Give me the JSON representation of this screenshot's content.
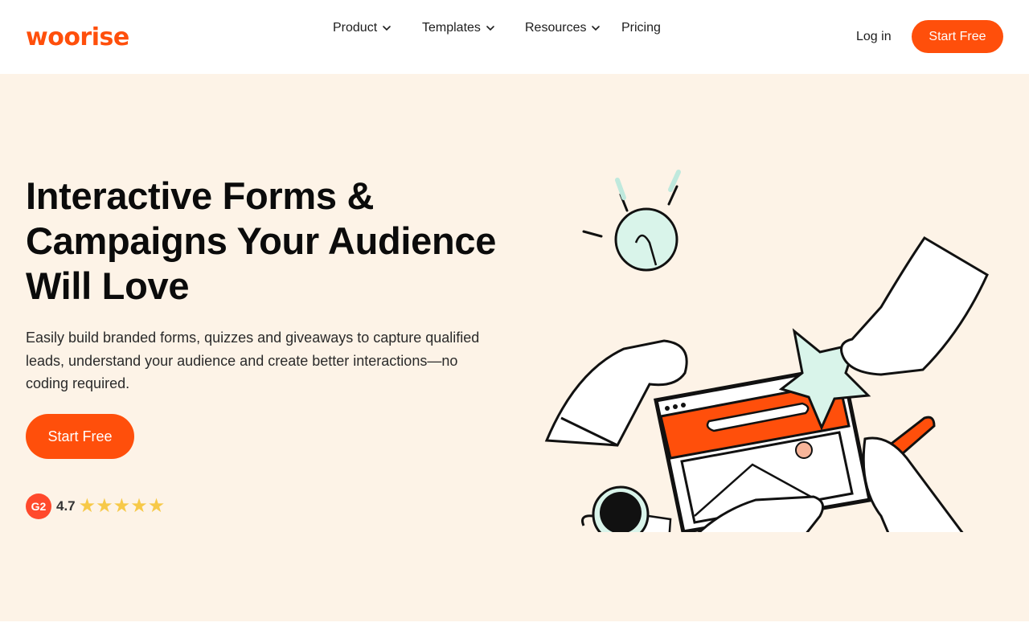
{
  "brand": {
    "name": "woorise",
    "color": "#ff4f0b"
  },
  "nav": {
    "items": [
      {
        "label": "Product",
        "has_dropdown": true
      },
      {
        "label": "Templates",
        "has_dropdown": true
      },
      {
        "label": "Resources",
        "has_dropdown": true
      },
      {
        "label": "Pricing",
        "has_dropdown": false
      }
    ],
    "login_label": "Log in",
    "cta_label": "Start Free"
  },
  "hero": {
    "title": "Interactive Forms & Campaigns Your Audience Will Love",
    "subtitle": "Easily build branded forms, quizzes and giveaways to capture qualified leads, understand your audience and create better interactions—no coding required.",
    "cta_label": "Start Free",
    "rating": {
      "badge": "G2",
      "value": "4.7",
      "stars": 5
    },
    "background": "#fdf3e7"
  },
  "icons": {
    "chevron": "chevron-down-icon",
    "star": "star-icon",
    "g2": "g2-logo-icon"
  }
}
